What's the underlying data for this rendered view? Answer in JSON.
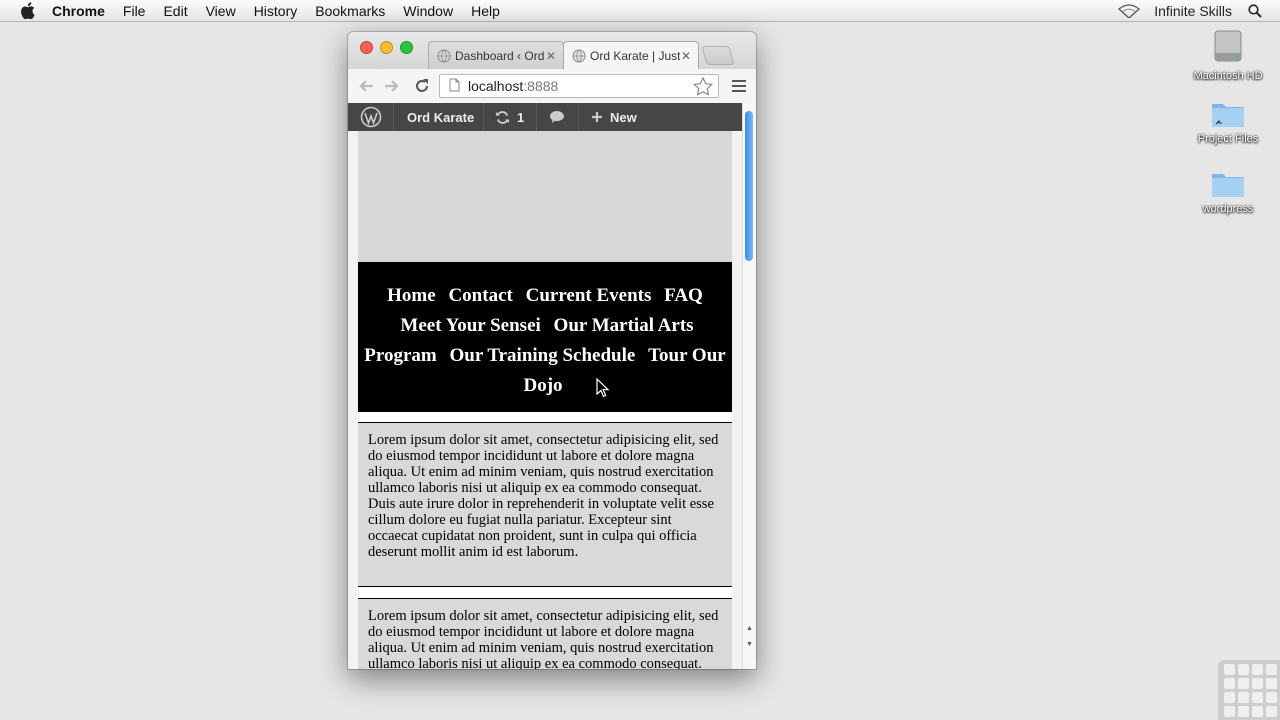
{
  "menubar": {
    "app": "Chrome",
    "items": [
      "File",
      "Edit",
      "View",
      "History",
      "Bookmarks",
      "Window",
      "Help"
    ],
    "user": "Infinite Skills"
  },
  "desktop": {
    "icons": [
      {
        "label": "Macintosh HD",
        "icon": "hard-drive-icon"
      },
      {
        "label": "Project Files",
        "icon": "folder-icon"
      },
      {
        "label": "wordpress",
        "icon": "folder-icon"
      }
    ]
  },
  "browser": {
    "tabs": [
      {
        "title": "Dashboard ‹ Ord",
        "active": false
      },
      {
        "title": "Ord Karate | Just",
        "active": true
      }
    ],
    "url_host": "localhost",
    "url_port": ":8888"
  },
  "adminbar": {
    "site": "Ord Karate",
    "updates": "1",
    "new_label": "New"
  },
  "site": {
    "nav": [
      "Home",
      "Contact",
      "Current Events",
      "FAQ",
      "Meet Your Sensei",
      "Our Martial Arts Program",
      "Our Training Schedule",
      "Tour Our Dojo"
    ],
    "paragraphs": [
      "Lorem ipsum dolor sit amet, consectetur adipisicing elit, sed do eiusmod tempor incididunt ut labore et dolore magna aliqua. Ut enim ad minim veniam, quis nostrud exercitation ullamco laboris nisi ut aliquip ex ea commodo consequat. Duis aute irure dolor in reprehenderit in voluptate velit esse cillum dolore eu fugiat nulla pariatur. Excepteur sint occaecat cupidatat non proident, sunt in culpa qui officia deserunt mollit anim id est laborum.",
      "Lorem ipsum dolor sit amet, consectetur adipisicing elit, sed do eiusmod tempor incididunt ut labore et dolore magna aliqua. Ut enim ad minim veniam, quis nostrud exercitation ullamco laboris nisi ut aliquip ex ea commodo consequat."
    ]
  },
  "colors": {
    "adminbar": "#464646",
    "nav_bg": "#000000",
    "content_box": "#d9d9d9"
  }
}
